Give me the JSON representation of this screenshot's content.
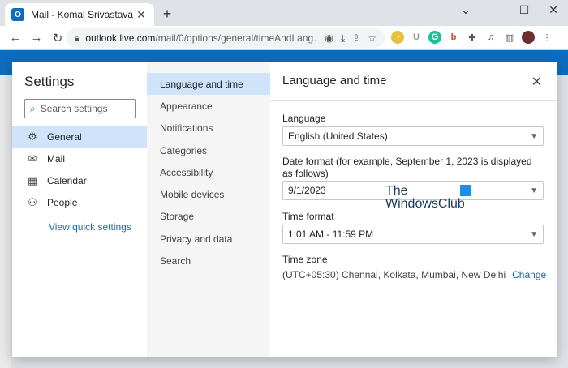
{
  "browser": {
    "tab_title": "Mail - Komal Srivastava - Outlook",
    "tab_close": "✕",
    "new_tab": "+",
    "window": {
      "minimize": "⌄",
      "restore": "—",
      "maximize": "☐",
      "close": "✕"
    },
    "nav": {
      "back": "←",
      "forward": "→",
      "reload": "↻"
    },
    "url_host": "outlook.live.com",
    "url_path": "/mail/0/options/general/timeAndLang..."
  },
  "settings": {
    "title": "Settings",
    "search_placeholder": "Search settings",
    "nav": [
      {
        "label": "General",
        "icon": "gear-icon",
        "glyph": "⚙"
      },
      {
        "label": "Mail",
        "icon": "mail-icon",
        "glyph": "✉"
      },
      {
        "label": "Calendar",
        "icon": "calendar-icon",
        "glyph": "▦"
      },
      {
        "label": "People",
        "icon": "people-icon",
        "glyph": "⚇"
      }
    ],
    "quick_link": "View quick settings",
    "sub": [
      "Language and time",
      "Appearance",
      "Notifications",
      "Categories",
      "Accessibility",
      "Mobile devices",
      "Storage",
      "Privacy and data",
      "Search"
    ],
    "panel": {
      "title": "Language and time",
      "language_label": "Language",
      "language_value": "English (United States)",
      "date_label": "Date format (for example, September 1, 2023 is displayed as follows)",
      "date_value": "9/1/2023",
      "time_label": "Time format",
      "time_value": "1:01 AM - 11:59 PM",
      "timezone_label": "Time zone",
      "timezone_value": "(UTC+05:30) Chennai, Kolkata, Mumbai, New Delhi",
      "change_label": "Change"
    }
  },
  "watermark": {
    "line1": "The",
    "line2": "WindowsClub"
  },
  "colors": {
    "accent": "#0f6cbd",
    "selected": "#cfe4fa"
  }
}
